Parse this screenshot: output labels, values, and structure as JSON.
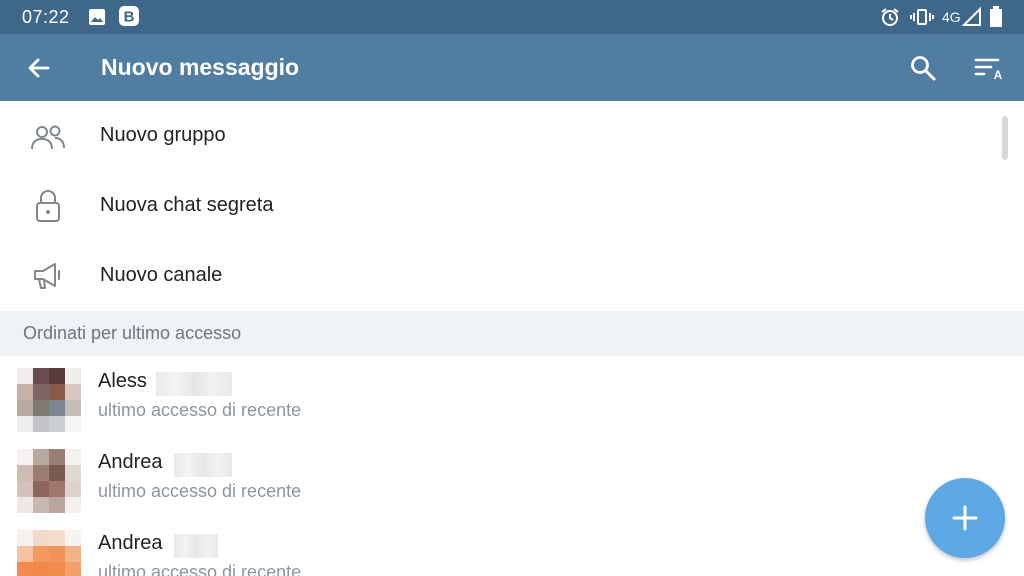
{
  "status_bar": {
    "time": "07:22",
    "network": "4G",
    "icons": [
      "image-icon",
      "b-app-icon",
      "alarm-icon",
      "vibrate-icon",
      "signal-icon",
      "battery-icon"
    ]
  },
  "app_bar": {
    "title": "Nuovo messaggio",
    "icons": [
      "back-arrow-icon",
      "search-icon",
      "sort-icon"
    ],
    "color": "#527da3"
  },
  "menu": [
    {
      "label": "Nuovo gruppo",
      "icon": "group-icon"
    },
    {
      "label": "Nuova chat segreta",
      "icon": "lock-icon"
    },
    {
      "label": "Nuovo canale",
      "icon": "megaphone-icon"
    }
  ],
  "section_header": "Ordinati per ultimo accesso",
  "contacts": [
    {
      "name": "Aless",
      "status": "ultimo accesso di recente"
    },
    {
      "name": "Andrea",
      "status": "ultimo accesso di recente"
    },
    {
      "name": "Andrea",
      "status": "ultimo accesso di recente"
    }
  ],
  "fab": {
    "icon": "plus-icon",
    "color": "#5ea8e5"
  }
}
